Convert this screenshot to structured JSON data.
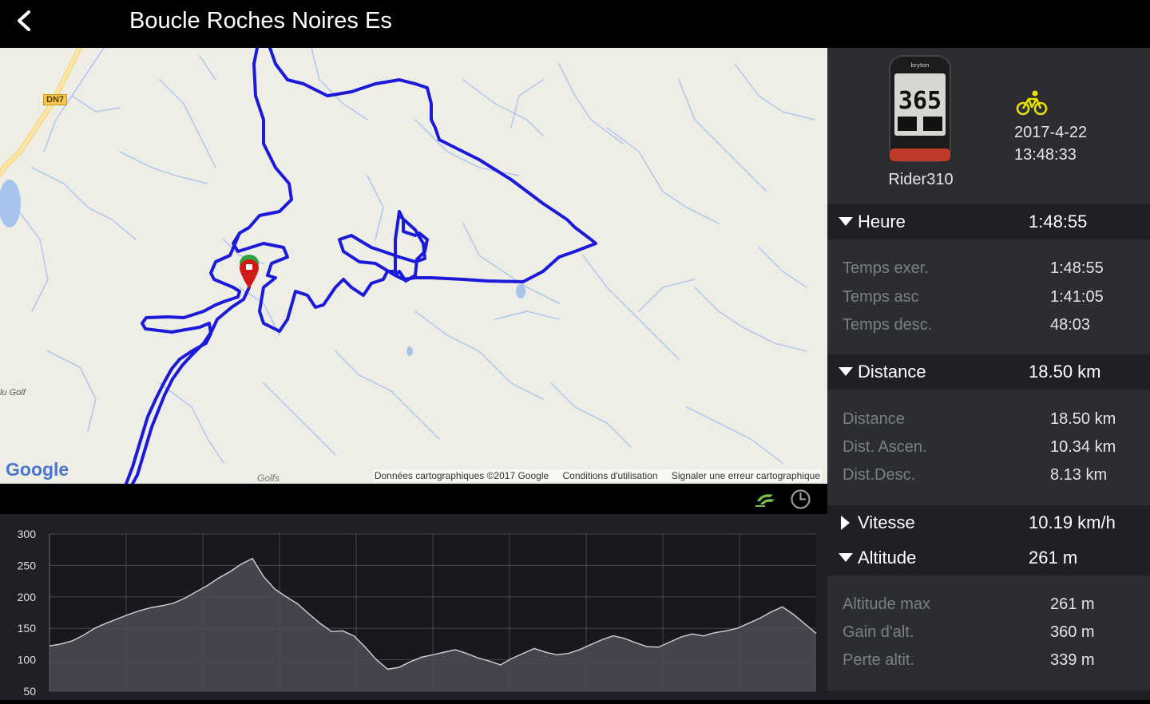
{
  "header": {
    "title": "Boucle Roches Noires Es",
    "back_icon": "chevron-left-icon"
  },
  "map": {
    "road_label_dn7": "DN7",
    "place_golf_left": "lu Golf",
    "place_golfs_bottom": "Golfs",
    "google_logo": "Google",
    "attribution": {
      "data": "Données cartographiques ©2017 Google",
      "terms": "Conditions d'utilisation",
      "report": "Signaler une erreur cartographique"
    },
    "route_color": "#1a1ad8",
    "marker_icon": "start-finish-pin-icon"
  },
  "chart_toolbar": {
    "speed_icon": "speed-toggle-icon",
    "clock_icon": "clock-icon"
  },
  "chart_data": {
    "type": "area",
    "title": "",
    "xlabel": "",
    "ylabel": "",
    "ylim": [
      50,
      300
    ],
    "yticks": [
      50,
      100,
      150,
      200,
      250,
      300
    ],
    "grid": true,
    "series": [
      {
        "values": [
          122,
          125,
          130,
          139,
          150,
          158,
          165,
          172,
          178,
          183,
          186,
          190,
          198,
          208,
          218,
          230,
          240,
          252,
          261,
          232,
          212,
          200,
          189,
          173,
          158,
          145,
          146,
          138,
          120,
          100,
          85,
          88,
          97,
          104,
          108,
          112,
          116,
          110,
          103,
          98,
          92,
          102,
          110,
          118,
          112,
          108,
          110,
          116,
          124,
          132,
          138,
          134,
          127,
          121,
          120,
          128,
          136,
          141,
          138,
          143,
          146,
          150,
          158,
          166,
          176,
          184,
          172,
          157,
          142
        ]
      }
    ]
  },
  "device": {
    "name": "Rider310",
    "screen_value": "365",
    "bike_icon": "bicycle-icon"
  },
  "activity": {
    "date": "2017-4-22",
    "time": "13:48:33"
  },
  "sections": {
    "heure": {
      "label": "Heure",
      "value": "1:48:55",
      "expanded": true,
      "rows": [
        {
          "label": "Temps exer.",
          "value": "1:48:55"
        },
        {
          "label": "Temps asc",
          "value": "1:41:05"
        },
        {
          "label": "Temps desc.",
          "value": "48:03"
        }
      ]
    },
    "distance": {
      "label": "Distance",
      "value": "18.50 km",
      "expanded": true,
      "rows": [
        {
          "label": "Distance",
          "value": "18.50 km"
        },
        {
          "label": "Dist. Ascen.",
          "value": "10.34 km"
        },
        {
          "label": "Dist.Desc.",
          "value": "8.13 km"
        }
      ]
    },
    "vitesse": {
      "label": "Vitesse",
      "value": "10.19 km/h",
      "expanded": false
    },
    "altitude": {
      "label": "Altitude",
      "value": "261 m",
      "expanded": true,
      "rows": [
        {
          "label": "Altitude max",
          "value": "261 m"
        },
        {
          "label": "Gain d'alt.",
          "value": "360 m"
        },
        {
          "label": "Perte altit.",
          "value": "339 m"
        }
      ]
    }
  }
}
